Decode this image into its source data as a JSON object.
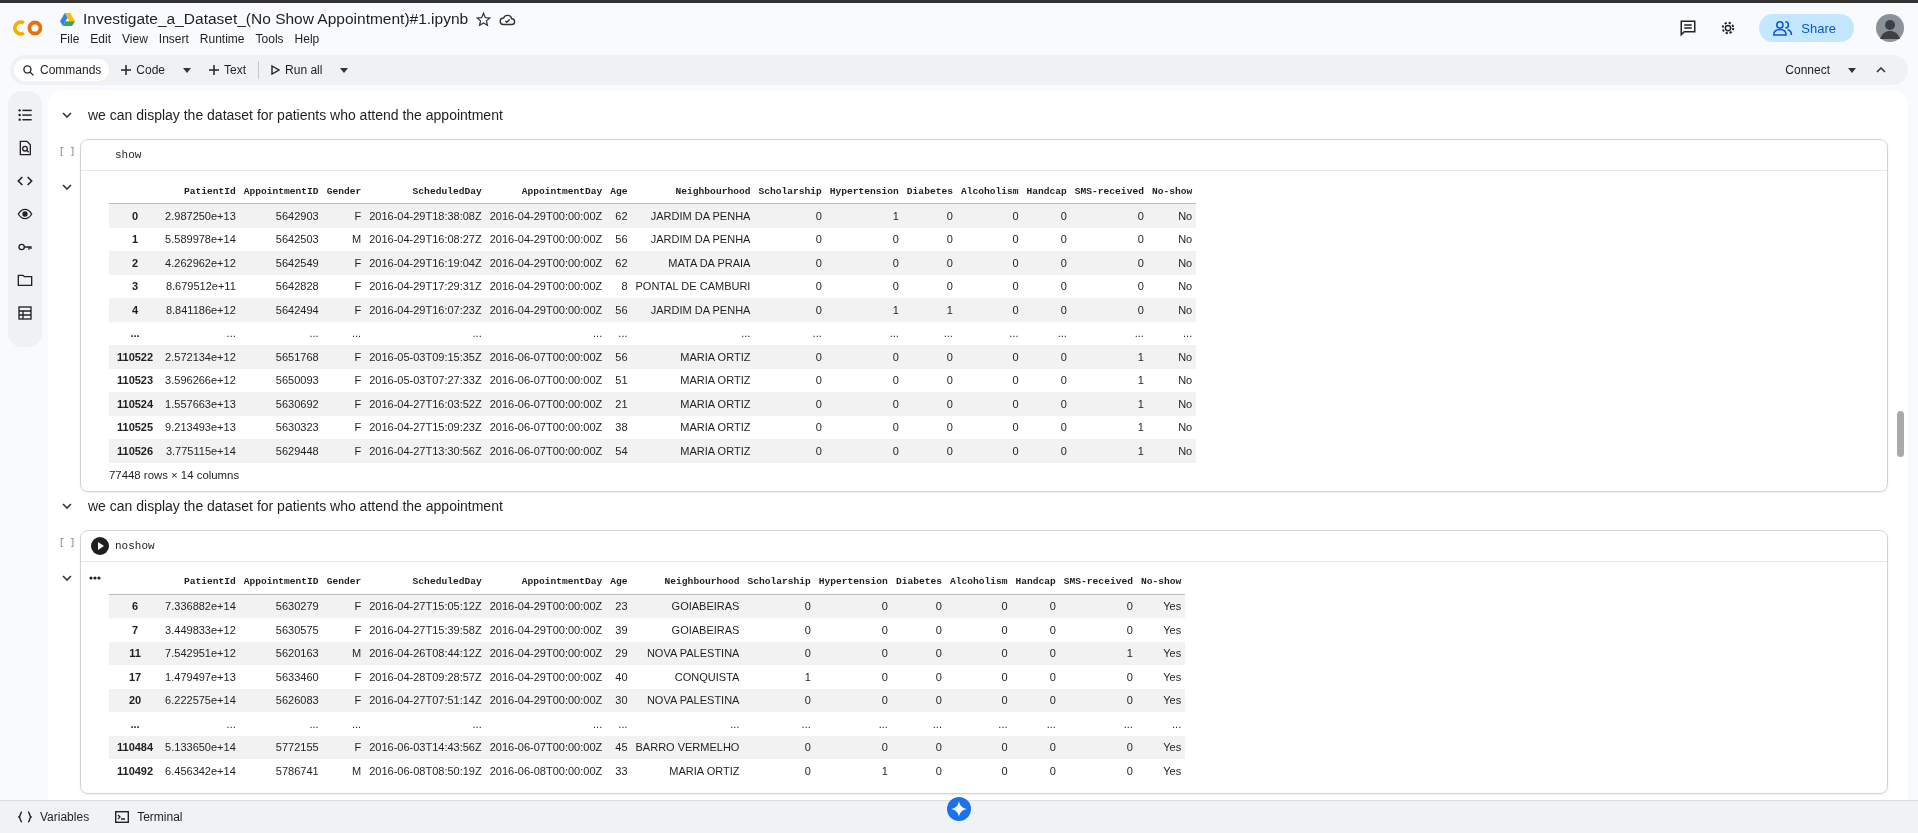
{
  "notebook": {
    "title": "Investigate_a_Dataset_(No Show Appointment)#1.ipynb",
    "menu": [
      "File",
      "Edit",
      "View",
      "Insert",
      "Runtime",
      "Tools",
      "Help"
    ],
    "share_label": "Share"
  },
  "toolbar": {
    "commands": "Commands",
    "add_code": "Code",
    "add_text": "Text",
    "run_all": "Run all",
    "connect": "Connect"
  },
  "cells": [
    {
      "kind": "text",
      "text": "we can display the dataset for patients who attend the appointment"
    },
    {
      "kind": "code",
      "exec": "[ ]",
      "code": "show",
      "run_button": false,
      "output_menu": false,
      "table": {
        "columns": [
          "PatientId",
          "AppointmentID",
          "Gender",
          "ScheduledDay",
          "AppointmentDay",
          "Age",
          "Neighbourhood",
          "Scholarship",
          "Hypertension",
          "Diabetes",
          "Alcoholism",
          "Handcap",
          "SMS-received",
          "No-show"
        ],
        "rows": [
          {
            "index": "0",
            "cells": [
              "2.987250e+13",
              "5642903",
              "F",
              "2016-04-29T18:38:08Z",
              "2016-04-29T00:00:00Z",
              "62",
              "JARDIM DA PENHA",
              "0",
              "1",
              "0",
              "0",
              "0",
              "0",
              "No"
            ]
          },
          {
            "index": "1",
            "cells": [
              "5.589978e+14",
              "5642503",
              "M",
              "2016-04-29T16:08:27Z",
              "2016-04-29T00:00:00Z",
              "56",
              "JARDIM DA PENHA",
              "0",
              "0",
              "0",
              "0",
              "0",
              "0",
              "No"
            ]
          },
          {
            "index": "2",
            "cells": [
              "4.262962e+12",
              "5642549",
              "F",
              "2016-04-29T16:19:04Z",
              "2016-04-29T00:00:00Z",
              "62",
              "MATA DA PRAIA",
              "0",
              "0",
              "0",
              "0",
              "0",
              "0",
              "No"
            ]
          },
          {
            "index": "3",
            "cells": [
              "8.679512e+11",
              "5642828",
              "F",
              "2016-04-29T17:29:31Z",
              "2016-04-29T00:00:00Z",
              "8",
              "PONTAL DE CAMBURI",
              "0",
              "0",
              "0",
              "0",
              "0",
              "0",
              "No"
            ]
          },
          {
            "index": "4",
            "cells": [
              "8.841186e+12",
              "5642494",
              "F",
              "2016-04-29T16:07:23Z",
              "2016-04-29T00:00:00Z",
              "56",
              "JARDIM DA PENHA",
              "0",
              "1",
              "1",
              "0",
              "0",
              "0",
              "No"
            ]
          },
          {
            "index": "...",
            "cells": [
              "...",
              "...",
              "...",
              "...",
              "...",
              "...",
              "...",
              "...",
              "...",
              "...",
              "...",
              "...",
              "...",
              "..."
            ]
          },
          {
            "index": "110522",
            "cells": [
              "2.572134e+12",
              "5651768",
              "F",
              "2016-05-03T09:15:35Z",
              "2016-06-07T00:00:00Z",
              "56",
              "MARIA ORTIZ",
              "0",
              "0",
              "0",
              "0",
              "0",
              "1",
              "No"
            ]
          },
          {
            "index": "110523",
            "cells": [
              "3.596266e+12",
              "5650093",
              "F",
              "2016-05-03T07:27:33Z",
              "2016-06-07T00:00:00Z",
              "51",
              "MARIA ORTIZ",
              "0",
              "0",
              "0",
              "0",
              "0",
              "1",
              "No"
            ]
          },
          {
            "index": "110524",
            "cells": [
              "1.557663e+13",
              "5630692",
              "F",
              "2016-04-27T16:03:52Z",
              "2016-06-07T00:00:00Z",
              "21",
              "MARIA ORTIZ",
              "0",
              "0",
              "0",
              "0",
              "0",
              "1",
              "No"
            ]
          },
          {
            "index": "110525",
            "cells": [
              "9.213493e+13",
              "5630323",
              "F",
              "2016-04-27T15:09:23Z",
              "2016-06-07T00:00:00Z",
              "38",
              "MARIA ORTIZ",
              "0",
              "0",
              "0",
              "0",
              "0",
              "1",
              "No"
            ]
          },
          {
            "index": "110526",
            "cells": [
              "3.775115e+14",
              "5629448",
              "F",
              "2016-04-27T13:30:56Z",
              "2016-06-07T00:00:00Z",
              "54",
              "MARIA ORTIZ",
              "0",
              "0",
              "0",
              "0",
              "0",
              "1",
              "No"
            ]
          }
        ],
        "footer": "77448 rows × 14 columns"
      }
    },
    {
      "kind": "text",
      "text": "we can display the dataset for patients who attend the appointment"
    },
    {
      "kind": "code",
      "exec": "[ ]",
      "code": "noshow",
      "run_button": true,
      "output_menu": true,
      "table": {
        "columns": [
          "PatientId",
          "AppointmentID",
          "Gender",
          "ScheduledDay",
          "AppointmentDay",
          "Age",
          "Neighbourhood",
          "Scholarship",
          "Hypertension",
          "Diabetes",
          "Alcoholism",
          "Handcap",
          "SMS-received",
          "No-show"
        ],
        "rows": [
          {
            "index": "6",
            "cells": [
              "7.336882e+14",
              "5630279",
              "F",
              "2016-04-27T15:05:12Z",
              "2016-04-29T00:00:00Z",
              "23",
              "GOIABEIRAS",
              "0",
              "0",
              "0",
              "0",
              "0",
              "0",
              "Yes"
            ]
          },
          {
            "index": "7",
            "cells": [
              "3.449833e+12",
              "5630575",
              "F",
              "2016-04-27T15:39:58Z",
              "2016-04-29T00:00:00Z",
              "39",
              "GOIABEIRAS",
              "0",
              "0",
              "0",
              "0",
              "0",
              "0",
              "Yes"
            ]
          },
          {
            "index": "11",
            "cells": [
              "7.542951e+12",
              "5620163",
              "M",
              "2016-04-26T08:44:12Z",
              "2016-04-29T00:00:00Z",
              "29",
              "NOVA PALESTINA",
              "0",
              "0",
              "0",
              "0",
              "0",
              "1",
              "Yes"
            ]
          },
          {
            "index": "17",
            "cells": [
              "1.479497e+13",
              "5633460",
              "F",
              "2016-04-28T09:28:57Z",
              "2016-04-29T00:00:00Z",
              "40",
              "CONQUISTA",
              "1",
              "0",
              "0",
              "0",
              "0",
              "0",
              "Yes"
            ]
          },
          {
            "index": "20",
            "cells": [
              "6.222575e+14",
              "5626083",
              "F",
              "2016-04-27T07:51:14Z",
              "2016-04-29T00:00:00Z",
              "30",
              "NOVA PALESTINA",
              "0",
              "0",
              "0",
              "0",
              "0",
              "0",
              "Yes"
            ]
          },
          {
            "index": "...",
            "cells": [
              "...",
              "...",
              "...",
              "...",
              "...",
              "...",
              "...",
              "...",
              "...",
              "...",
              "...",
              "...",
              "...",
              "..."
            ]
          },
          {
            "index": "110484",
            "cells": [
              "5.133650e+14",
              "5772155",
              "F",
              "2016-06-03T14:43:56Z",
              "2016-06-07T00:00:00Z",
              "45",
              "BARRO VERMELHO",
              "0",
              "0",
              "0",
              "0",
              "0",
              "0",
              "Yes"
            ]
          },
          {
            "index": "110492",
            "cells": [
              "6.456342e+14",
              "5786741",
              "M",
              "2016-06-08T08:50:19Z",
              "2016-06-08T00:00:00Z",
              "33",
              "MARIA ORTIZ",
              "0",
              "1",
              "0",
              "0",
              "0",
              "0",
              "Yes"
            ]
          }
        ]
      }
    }
  ],
  "bottom_bar": [
    "Variables",
    "Terminal"
  ]
}
